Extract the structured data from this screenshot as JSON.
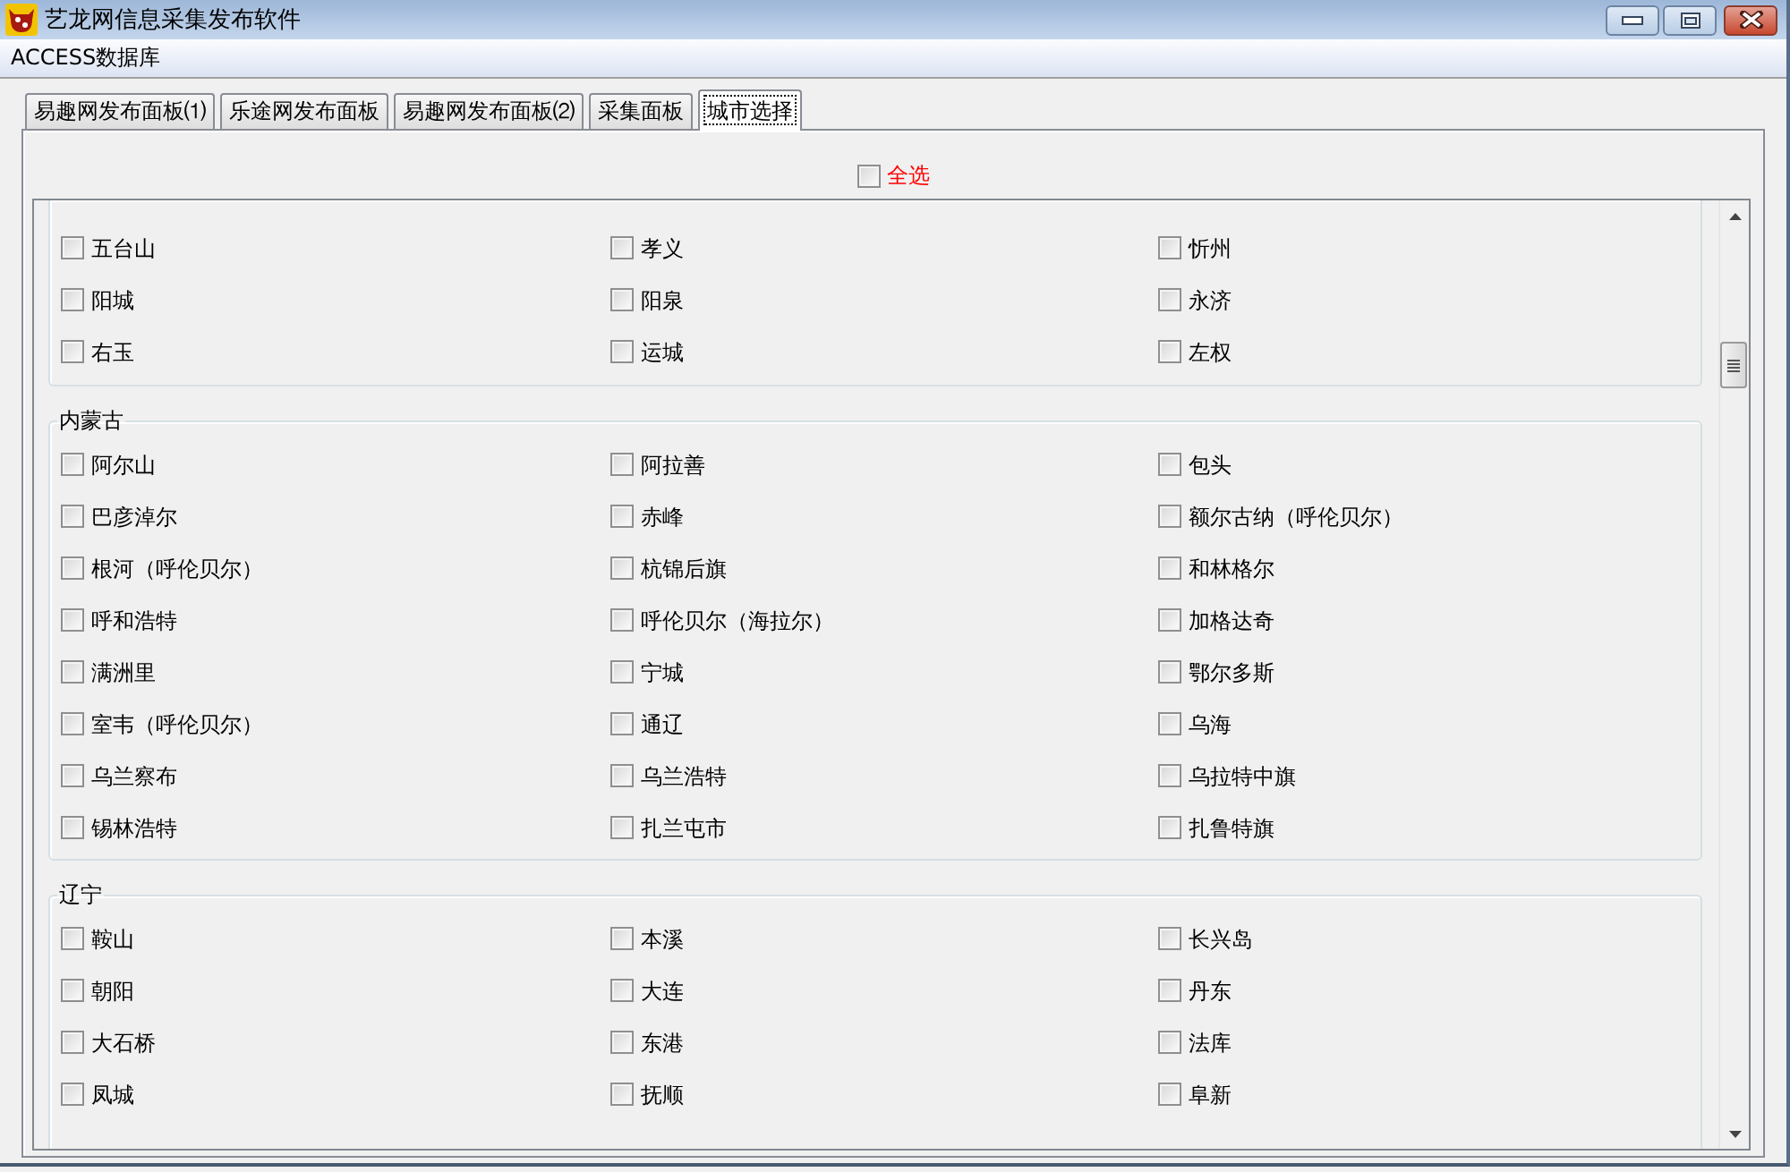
{
  "window": {
    "title": "艺龙网信息采集发布软件"
  },
  "menu": [
    {
      "label": "ACCESS数据库"
    }
  ],
  "tabs": [
    {
      "label": "易趣网发布面板⑴",
      "selected": false
    },
    {
      "label": "乐途网发布面板",
      "selected": false
    },
    {
      "label": "易趣网发布面板⑵",
      "selected": false
    },
    {
      "label": "采集面板",
      "selected": false
    },
    {
      "label": "城市选择",
      "selected": true
    }
  ],
  "select_all": {
    "label": "全选",
    "checked": false
  },
  "groups": [
    {
      "items": [
        {
          "label": "五台山",
          "checked": false
        },
        {
          "label": "孝义",
          "checked": false
        },
        {
          "label": "忻州",
          "checked": false
        },
        {
          "label": "阳城",
          "checked": false
        },
        {
          "label": "阳泉",
          "checked": false
        },
        {
          "label": "永济",
          "checked": false
        },
        {
          "label": "右玉",
          "checked": false
        },
        {
          "label": "运城",
          "checked": false
        },
        {
          "label": "左权",
          "checked": false
        }
      ]
    },
    {
      "title": "内蒙古",
      "items": [
        {
          "label": "阿尔山",
          "checked": false
        },
        {
          "label": "阿拉善",
          "checked": false
        },
        {
          "label": "包头",
          "checked": false
        },
        {
          "label": "巴彦淖尔",
          "checked": false
        },
        {
          "label": "赤峰",
          "checked": false
        },
        {
          "label": "额尔古纳（呼伦贝尔）",
          "checked": false
        },
        {
          "label": "根河（呼伦贝尔）",
          "checked": false
        },
        {
          "label": "杭锦后旗",
          "checked": false
        },
        {
          "label": "和林格尔",
          "checked": false
        },
        {
          "label": "呼和浩特",
          "checked": false
        },
        {
          "label": "呼伦贝尔（海拉尔）",
          "checked": false
        },
        {
          "label": "加格达奇",
          "checked": false
        },
        {
          "label": "满洲里",
          "checked": false
        },
        {
          "label": "宁城",
          "checked": false
        },
        {
          "label": "鄂尔多斯",
          "checked": false
        },
        {
          "label": "室韦（呼伦贝尔）",
          "checked": false
        },
        {
          "label": "通辽",
          "checked": false
        },
        {
          "label": "乌海",
          "checked": false
        },
        {
          "label": "乌兰察布",
          "checked": false
        },
        {
          "label": "乌兰浩特",
          "checked": false
        },
        {
          "label": "乌拉特中旗",
          "checked": false
        },
        {
          "label": "锡林浩特",
          "checked": false
        },
        {
          "label": "扎兰屯市",
          "checked": false
        },
        {
          "label": "扎鲁特旗",
          "checked": false
        }
      ]
    },
    {
      "title": "辽宁",
      "items": [
        {
          "label": "鞍山",
          "checked": false
        },
        {
          "label": "本溪",
          "checked": false
        },
        {
          "label": "长兴岛",
          "checked": false
        },
        {
          "label": "朝阳",
          "checked": false
        },
        {
          "label": "大连",
          "checked": false
        },
        {
          "label": "丹东",
          "checked": false
        },
        {
          "label": "大石桥",
          "checked": false
        },
        {
          "label": "东港",
          "checked": false
        },
        {
          "label": "法库",
          "checked": false
        },
        {
          "label": "凤城",
          "checked": false
        },
        {
          "label": "抚顺",
          "checked": false
        },
        {
          "label": "阜新",
          "checked": false
        }
      ]
    }
  ]
}
